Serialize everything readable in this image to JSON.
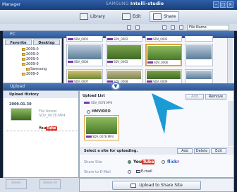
{
  "app": {
    "title": "Manager",
    "brand_light": "SAMSUNG",
    "brand_bold": "Intelli-studio"
  },
  "toolbar": {
    "library": "Library",
    "edit": "Edit",
    "share": "Share"
  },
  "viewbar": {
    "view_mode": "File Name"
  },
  "panel": {
    "pc_label": "PC"
  },
  "tree": {
    "tabs": [
      "Favorite",
      "Desktop"
    ],
    "items": [
      "2009-0",
      "2009-0",
      "2009-0",
      "2009-0",
      "Samsung",
      "2009-0"
    ]
  },
  "grid": {
    "captions": [
      "SDV_0001",
      "SDV_0002",
      "SDV_0003",
      "SDV_0004",
      "SDV_0005",
      "SDV_0006",
      "SDV_0007",
      "SDV_0008",
      "SDV_0009"
    ]
  },
  "upload": {
    "bar_label": "Upload",
    "toggle_icon": "▼"
  },
  "history": {
    "title": "Upload History",
    "date": "2009.01.30",
    "meta": [
      "File Name:",
      "SDV_0078.MP4"
    ],
    "site": "You",
    "site_badge": "Tube",
    "buttons": [
      "Delete",
      "Delete All"
    ]
  },
  "upload_list": {
    "title": "Upload List",
    "buttons": [
      "Add",
      "Remove"
    ],
    "file_name": "SDV_0078.MP4",
    "group": "HMVIDEO"
  },
  "site_select": {
    "label": "Select a site for uploading.",
    "buttons": [
      "Add",
      "Delete",
      "Edit"
    ],
    "share_site": "Share Site",
    "share_mail": "Share to E-Mail",
    "yt": "You",
    "yt_badge": "Tube",
    "flickr_a": "flick",
    "flickr_b": "r",
    "email": "E-mail"
  },
  "footer": {
    "upload_button": "Upload to Share Site"
  },
  "colors": {
    "accent": "#2f5898",
    "pointer": "#1a9bd6"
  }
}
